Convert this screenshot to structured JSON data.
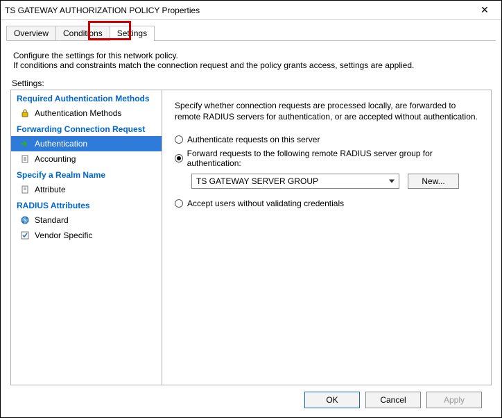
{
  "window": {
    "title": "TS GATEWAY AUTHORIZATION POLICY Properties",
    "close_glyph": "✕"
  },
  "tabs": {
    "overview": "Overview",
    "conditions": "Conditions",
    "settings": "Settings"
  },
  "description": {
    "line1": "Configure the settings for this network policy.",
    "line2": "If conditions and constraints match the connection request and the policy grants access, settings are applied."
  },
  "settings_label": "Settings:",
  "sidebar": {
    "groups": {
      "required_auth": "Required Authentication Methods",
      "forwarding": "Forwarding Connection Request",
      "realm": "Specify a Realm Name",
      "radius_attrs": "RADIUS Attributes"
    },
    "items": {
      "auth_methods": "Authentication Methods",
      "authentication": "Authentication",
      "accounting": "Accounting",
      "attribute": "Attribute",
      "standard": "Standard",
      "vendor": "Vendor Specific"
    }
  },
  "content": {
    "intro": "Specify whether connection requests are processed locally, are forwarded to remote RADIUS servers for authentication, or are accepted without authentication.",
    "radio_local": "Authenticate requests on this server",
    "radio_forward": "Forward requests to the following remote RADIUS server group for authentication:",
    "radio_nopass": "Accept users without validating credentials",
    "server_group_selected": "TS GATEWAY SERVER GROUP",
    "new_button": "New..."
  },
  "footer": {
    "ok": "OK",
    "cancel": "Cancel",
    "apply": "Apply"
  }
}
